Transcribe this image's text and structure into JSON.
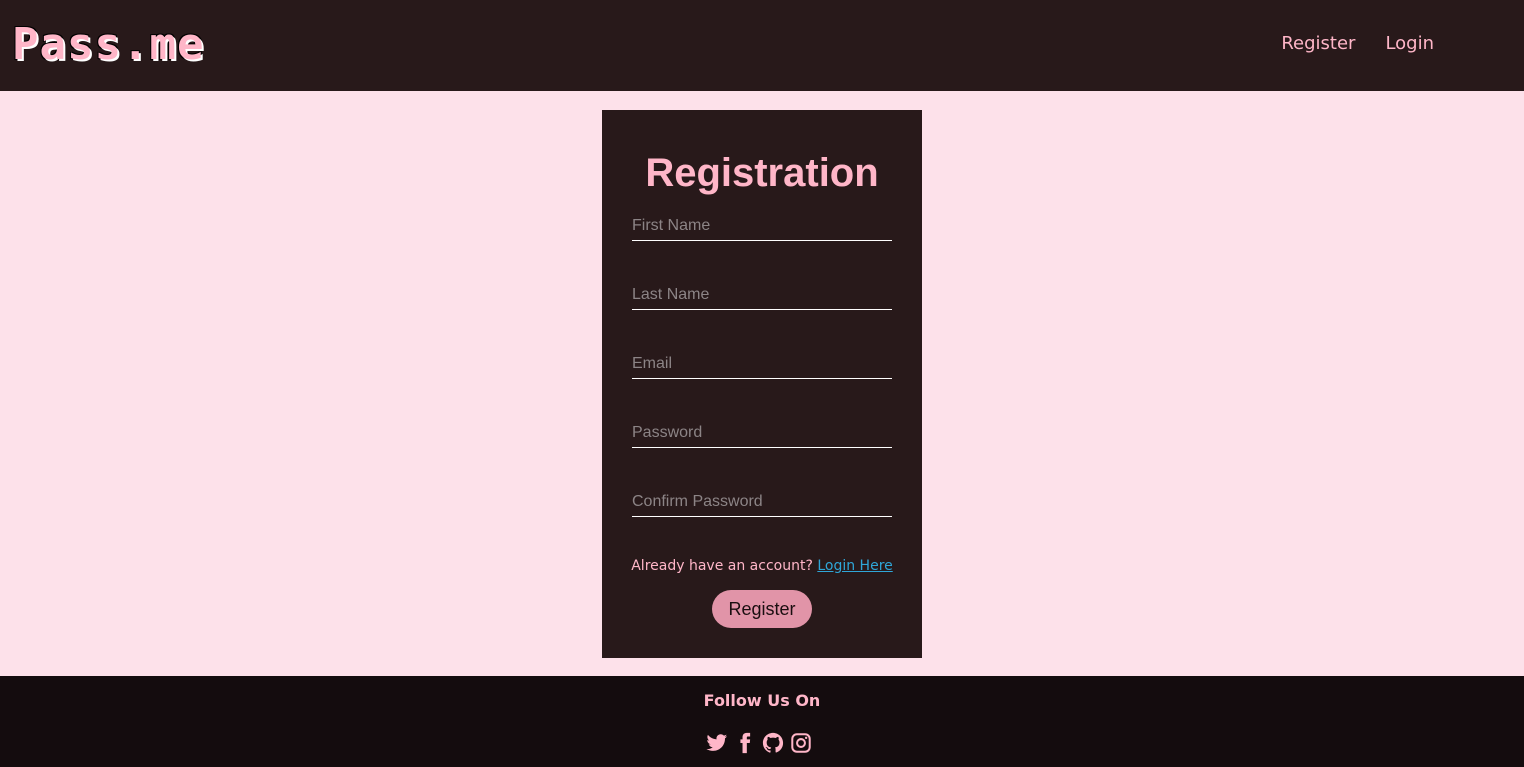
{
  "brand": {
    "logo_text": "Pass.me"
  },
  "nav": {
    "register_label": "Register",
    "login_label": "Login"
  },
  "form": {
    "title": "Registration",
    "first_name_placeholder": "First Name",
    "last_name_placeholder": "Last Name",
    "email_placeholder": "Email",
    "password_placeholder": "Password",
    "confirm_password_placeholder": "Confirm Password",
    "account_prompt": "Already have an account?",
    "login_link_label": "Login Here",
    "submit_label": "Register"
  },
  "footer": {
    "title": "Follow Us On",
    "icons": [
      "twitter-icon",
      "facebook-icon",
      "github-icon",
      "instagram-icon"
    ]
  },
  "colors": {
    "page_background": "#fde1ea",
    "header_background": "#28191a",
    "accent_pink": "#ffb6c8",
    "button_pink": "#e194a8",
    "link_blue": "#2fa6d8",
    "footer_background": "#140c0e"
  }
}
